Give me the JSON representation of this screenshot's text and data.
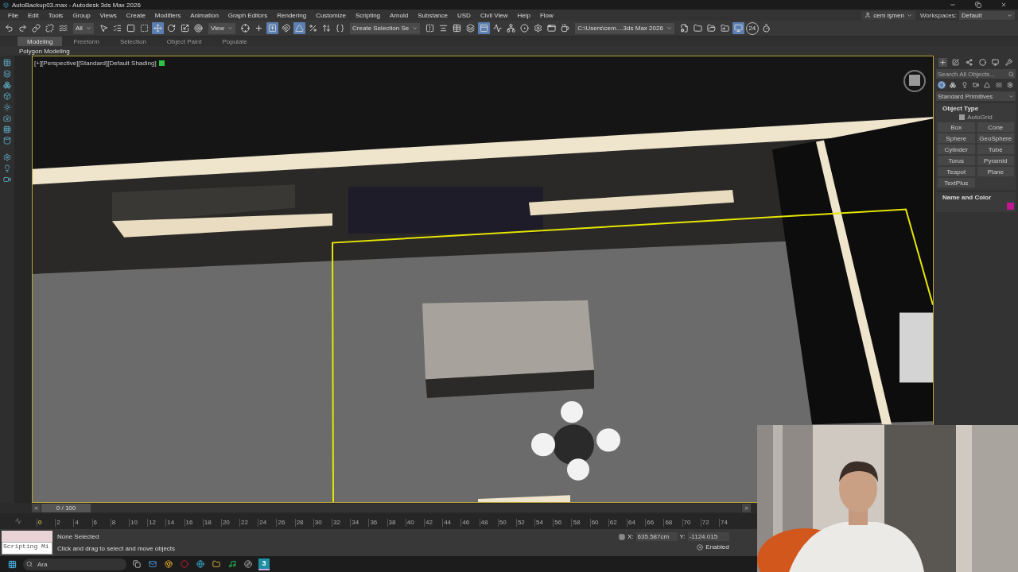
{
  "title_bar": {
    "title": "AutoBackup03.max - Autodesk 3ds Max 2026"
  },
  "menu_bar": {
    "items": [
      "File",
      "Edit",
      "Tools",
      "Group",
      "Views",
      "Create",
      "Modifiers",
      "Animation",
      "Graph Editors",
      "Rendering",
      "Customize",
      "Scripting",
      "Arnold",
      "Substance",
      "USD",
      "Civil View",
      "Help",
      "Flow"
    ],
    "user": "cem işmen",
    "workspaces_label": "Workspaces:",
    "workspace": "Default"
  },
  "toolbar": {
    "items": [
      {
        "kind": "button",
        "selected": false
      },
      {
        "kind": "button",
        "selected": false
      },
      {
        "kind": "button",
        "selected": false
      },
      {
        "kind": "button",
        "selected": false
      },
      {
        "kind": "button",
        "selected": false
      },
      {
        "kind": "dropdown",
        "value": "All"
      },
      {
        "kind": "button",
        "selected": false
      },
      {
        "kind": "button",
        "selected": false
      },
      {
        "kind": "button",
        "selected": false
      },
      {
        "kind": "button",
        "selected": false
      },
      {
        "kind": "button",
        "selected": true
      },
      {
        "kind": "button",
        "selected": false
      },
      {
        "kind": "button",
        "selected": false
      },
      {
        "kind": "button",
        "selected": false
      },
      {
        "kind": "dropdown",
        "value": "View"
      },
      {
        "kind": "button",
        "selected": false
      },
      {
        "kind": "button",
        "selected": false
      },
      {
        "kind": "button",
        "selected": true
      },
      {
        "kind": "button",
        "selected": false
      },
      {
        "kind": "button",
        "selected": true
      },
      {
        "kind": "button",
        "selected": false
      },
      {
        "kind": "button",
        "selected": false
      },
      {
        "kind": "button",
        "selected": false
      },
      {
        "kind": "dropdown",
        "value": "Create Selection Se"
      },
      {
        "kind": "button",
        "selected": false
      },
      {
        "kind": "button",
        "selected": false
      },
      {
        "kind": "button",
        "selected": false
      },
      {
        "kind": "button",
        "selected": false
      },
      {
        "kind": "button",
        "selected": true
      },
      {
        "kind": "button",
        "selected": false
      },
      {
        "kind": "button",
        "selected": false
      },
      {
        "kind": "button",
        "selected": false
      },
      {
        "kind": "button",
        "selected": false
      },
      {
        "kind": "button",
        "selected": false
      },
      {
        "kind": "button",
        "selected": false
      },
      {
        "kind": "dropdown",
        "value": "C:\\Users\\cem....3ds Max 2026"
      },
      {
        "kind": "button",
        "selected": false
      },
      {
        "kind": "button",
        "selected": false
      },
      {
        "kind": "button",
        "selected": false
      },
      {
        "kind": "button",
        "selected": false
      },
      {
        "kind": "button",
        "selected": true
      },
      {
        "kind": "badge",
        "label": "24"
      },
      {
        "kind": "button",
        "selected": false
      }
    ]
  },
  "ribbon": {
    "tabs": [
      {
        "label": "Modeling",
        "selected": true
      },
      {
        "label": "Freeform",
        "selected": false
      },
      {
        "label": "Selection",
        "selected": false
      },
      {
        "label": "Object Paint",
        "selected": false
      },
      {
        "label": "Populate",
        "selected": false
      }
    ],
    "panel": "Polygon Modeling"
  },
  "viewport": {
    "label": "[+][Perspective][Standard][Default Shading]",
    "kind": "picture"
  },
  "command_panel": {
    "tabs": [
      {
        "selected": true
      },
      {
        "selected": false
      },
      {
        "selected": false
      },
      {
        "selected": false
      },
      {
        "selected": false
      },
      {
        "selected": false
      }
    ],
    "search": {
      "placeholder": "Search All Objects..."
    },
    "categories": [
      {
        "selected": true
      },
      {
        "selected": false
      },
      {
        "selected": false
      },
      {
        "selected": false
      },
      {
        "selected": false
      },
      {
        "selected": false
      },
      {
        "selected": false
      }
    ],
    "dropdown": "Standard Primitives",
    "object_type": {
      "title": "Object Type",
      "autogrid": {
        "label": "AutoGrid",
        "checked": true
      },
      "buttons": [
        "Box",
        "Cone",
        "Sphere",
        "GeoSphere",
        "Cylinder",
        "Tube",
        "Torus",
        "Pyramid",
        "Teapot",
        "Plane",
        "TextPlus"
      ]
    },
    "name_and_color": {
      "title": "Name and Color",
      "color": "#c0168f"
    }
  },
  "timeline": {
    "prev": "<",
    "frame": "0 / 100",
    "level": 0,
    "next": ">",
    "ticks": [
      "0",
      "2",
      "4",
      "6",
      "8",
      "10",
      "12",
      "14",
      "16",
      "18",
      "20",
      "22",
      "24",
      "26",
      "28",
      "30",
      "32",
      "34",
      "36",
      "38",
      "40",
      "42",
      "44",
      "46",
      "48",
      "50",
      "52",
      "54",
      "56",
      "58",
      "60",
      "62",
      "64",
      "66",
      "68",
      "70",
      "72",
      "74"
    ]
  },
  "status_bar": {
    "script_listener": "Scripting Mi",
    "selection": "None Selected",
    "prompt": "Click and drag to select and move objects",
    "x_label": "X:",
    "x_value": "635.587cm",
    "y_label": "Y:",
    "y_value": "-1124.015",
    "grid": "Enabled"
  },
  "taskbar": {
    "search": {
      "placeholder": "Ara"
    },
    "app_label": "3"
  }
}
